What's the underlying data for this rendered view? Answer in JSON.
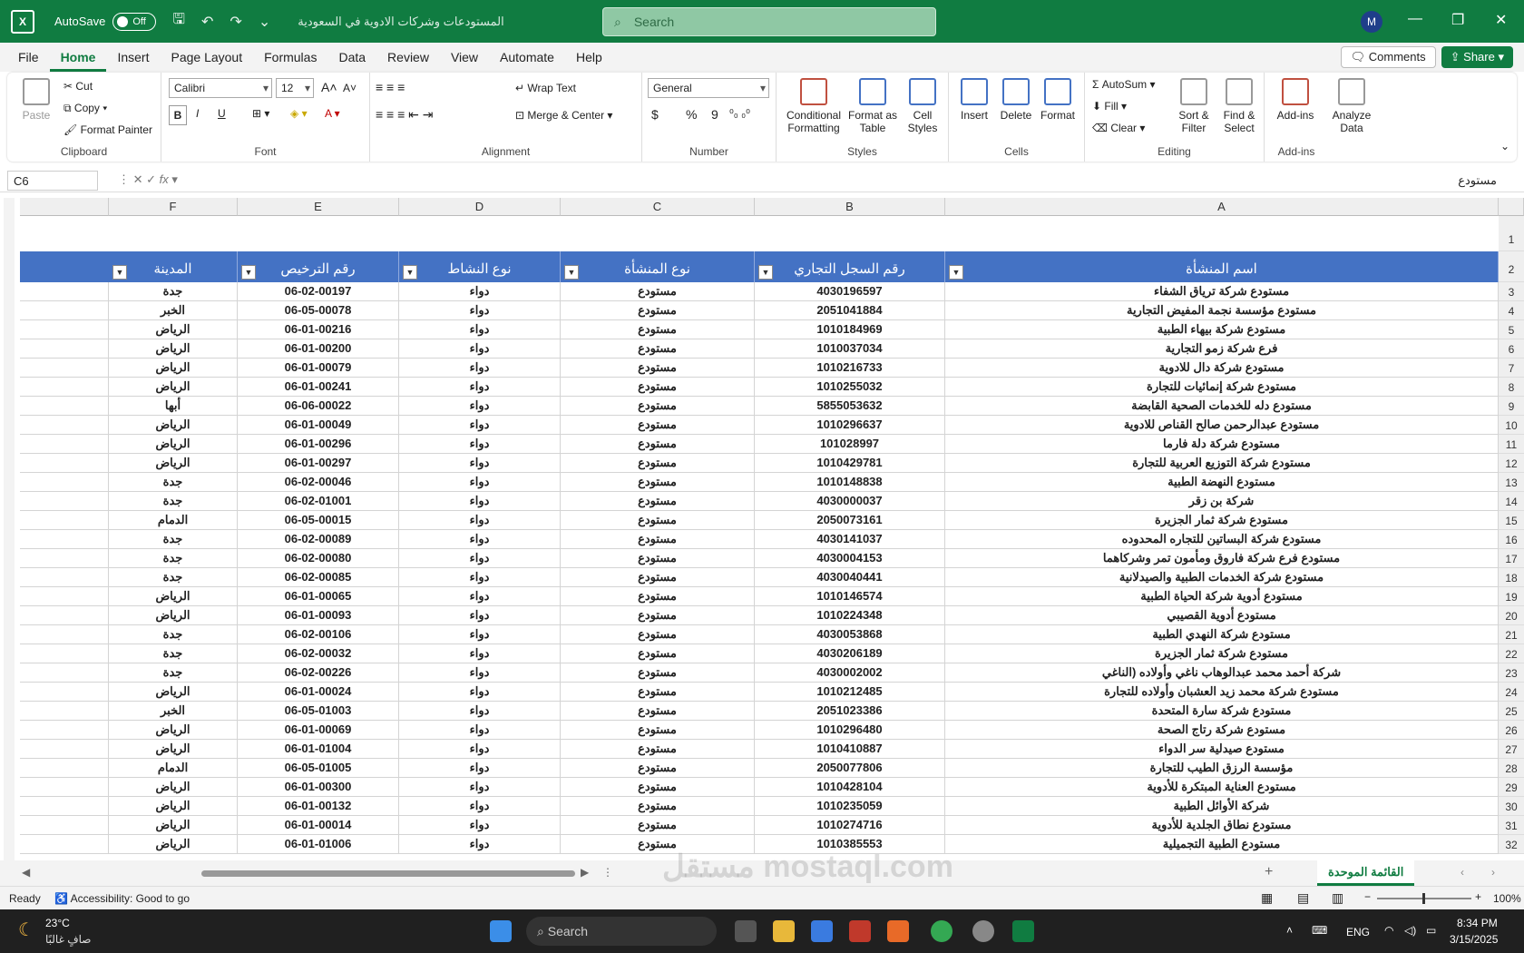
{
  "titlebar": {
    "autosave_label": "AutoSave",
    "autosave_state": "Off",
    "doc_title": "المستودعات وشركات الادوية في السعودية",
    "search_placeholder": "Search",
    "avatar": "M"
  },
  "menus": [
    "File",
    "Home",
    "Insert",
    "Page Layout",
    "Formulas",
    "Data",
    "Review",
    "View",
    "Automate",
    "Help"
  ],
  "menubar": {
    "comments": "Comments",
    "share": "Share"
  },
  "ribbon": {
    "clipboard": {
      "label": "Clipboard",
      "paste": "Paste",
      "cut": "Cut",
      "copy": "Copy",
      "format_painter": "Format Painter"
    },
    "font": {
      "label": "Font",
      "family": "Calibri",
      "size": "12",
      "bold": "B",
      "italic": "I",
      "underline": "U"
    },
    "alignment": {
      "label": "Alignment",
      "wrap": "Wrap Text",
      "merge": "Merge & Center"
    },
    "number": {
      "label": "Number",
      "format": "General",
      "currency": "$",
      "percent": "%",
      "comma": "9"
    },
    "styles": {
      "label": "Styles",
      "conditional": "Conditional Formatting",
      "format_table": "Format as Table",
      "cell_styles": "Cell Styles"
    },
    "cells": {
      "label": "Cells",
      "insert": "Insert",
      "delete": "Delete",
      "format": "Format"
    },
    "editing": {
      "label": "Editing",
      "autosum": "AutoSum",
      "fill": "Fill",
      "clear": "Clear",
      "sort": "Sort & Filter",
      "find": "Find & Select"
    },
    "addins": {
      "label": "Add-ins",
      "addins": "Add-ins",
      "analyze": "Analyze Data"
    }
  },
  "formula_bar": {
    "name_box": "C6",
    "fx": "fx",
    "content": "مستودع"
  },
  "columns": [
    "F",
    "E",
    "D",
    "C",
    "B",
    "A"
  ],
  "headers": {
    "F": "المدينة",
    "E": "رقم الترخيص",
    "D": "نوع النشاط",
    "C": "نوع المنشأة",
    "B": "رقم السجل التجاري",
    "A": "اسم المنشأة"
  },
  "rows": [
    {
      "n": "3",
      "A": "مستودع شركة ترياق الشفاء",
      "B": "4030196597",
      "C": "مستودع",
      "D": "دواء",
      "E": "06-02-00197",
      "F": "جدة"
    },
    {
      "n": "4",
      "A": "مستودع مؤسسة نجمة المفيض التجارية",
      "B": "2051041884",
      "C": "مستودع",
      "D": "دواء",
      "E": "06-05-00078",
      "F": "الخبر"
    },
    {
      "n": "5",
      "A": "مستودع شركة بيهاء الطبية",
      "B": "1010184969",
      "C": "مستودع",
      "D": "دواء",
      "E": "06-01-00216",
      "F": "الرياض"
    },
    {
      "n": "6",
      "A": "فرع شركة زمو التجارية",
      "B": "1010037034",
      "C": "مستودع",
      "D": "دواء",
      "E": "06-01-00200",
      "F": "الرياض"
    },
    {
      "n": "7",
      "A": "مستودع شركة دال للادوية",
      "B": "1010216733",
      "C": "مستودع",
      "D": "دواء",
      "E": "06-01-00079",
      "F": "الرياض"
    },
    {
      "n": "8",
      "A": "مستودع شركة إنمائيات للتجارة",
      "B": "1010255032",
      "C": "مستودع",
      "D": "دواء",
      "E": "06-01-00241",
      "F": "الرياض"
    },
    {
      "n": "9",
      "A": "مستودع دله للخدمات الصحية القابضة",
      "B": "5855053632",
      "C": "مستودع",
      "D": "دواء",
      "E": "06-06-00022",
      "F": "أبها"
    },
    {
      "n": "10",
      "A": "مستودع عبدالرحمن صالح القناص للادوية",
      "B": "1010296637",
      "C": "مستودع",
      "D": "دواء",
      "E": "06-01-00049",
      "F": "الرياض"
    },
    {
      "n": "11",
      "A": "مستودع شركة دلة فارما",
      "B": "101028997",
      "C": "مستودع",
      "D": "دواء",
      "E": "06-01-00296",
      "F": "الرياض"
    },
    {
      "n": "12",
      "A": "مستودع شركة التوزيع العربية للتجارة",
      "B": "1010429781",
      "C": "مستودع",
      "D": "دواء",
      "E": "06-01-00297",
      "F": "الرياض"
    },
    {
      "n": "13",
      "A": "مستودع النهضة الطبية",
      "B": "1010148838",
      "C": "مستودع",
      "D": "دواء",
      "E": "06-02-00046",
      "F": "جدة"
    },
    {
      "n": "14",
      "A": "شركة بن زقر",
      "B": "4030000037",
      "C": "مستودع",
      "D": "دواء",
      "E": "06-02-01001",
      "F": "جدة"
    },
    {
      "n": "15",
      "A": "مستودع شركة ثمار الجزيرة",
      "B": "2050073161",
      "C": "مستودع",
      "D": "دواء",
      "E": "06-05-00015",
      "F": "الدمام"
    },
    {
      "n": "16",
      "A": "مستودع شركة البساتين للتجاره المحدوده",
      "B": "4030141037",
      "C": "مستودع",
      "D": "دواء",
      "E": "06-02-00089",
      "F": "جدة"
    },
    {
      "n": "17",
      "A": "مستودع فرع شركة فاروق ومأمون تمر وشركاهما",
      "B": "4030004153",
      "C": "مستودع",
      "D": "دواء",
      "E": "06-02-00080",
      "F": "جدة"
    },
    {
      "n": "18",
      "A": "مستودع شركة الخدمات الطبية والصيدلانية",
      "B": "4030040441",
      "C": "مستودع",
      "D": "دواء",
      "E": "06-02-00085",
      "F": "جدة"
    },
    {
      "n": "19",
      "A": "مستودع أدوية شركة الحياة الطبية",
      "B": "1010146574",
      "C": "مستودع",
      "D": "دواء",
      "E": "06-01-00065",
      "F": "الرياض"
    },
    {
      "n": "20",
      "A": "مستودع أدوية القصيبي",
      "B": "1010224348",
      "C": "مستودع",
      "D": "دواء",
      "E": "06-01-00093",
      "F": "الرياض"
    },
    {
      "n": "21",
      "A": "مستودع شركة النهدي الطبية",
      "B": "4030053868",
      "C": "مستودع",
      "D": "دواء",
      "E": "06-02-00106",
      "F": "جدة"
    },
    {
      "n": "22",
      "A": "مستودع شركة ثمار الجزيرة",
      "B": "4030206189",
      "C": "مستودع",
      "D": "دواء",
      "E": "06-02-00032",
      "F": "جدة"
    },
    {
      "n": "23",
      "A": "شركة أحمد محمد عبدالوهاب ناغي وأولاده (الناغي",
      "B": "4030002002",
      "C": "مستودع",
      "D": "دواء",
      "E": "06-02-00226",
      "F": "جدة"
    },
    {
      "n": "24",
      "A": "مستودع شركة محمد زيد العشبان وأولاده للتجارة",
      "B": "1010212485",
      "C": "مستودع",
      "D": "دواء",
      "E": "06-01-00024",
      "F": "الرياض"
    },
    {
      "n": "25",
      "A": "مستودع شركة سارة المتحدة",
      "B": "2051023386",
      "C": "مستودع",
      "D": "دواء",
      "E": "06-05-01003",
      "F": "الخبر"
    },
    {
      "n": "26",
      "A": "مستودع شركة رتاج الصحة",
      "B": "1010296480",
      "C": "مستودع",
      "D": "دواء",
      "E": "06-01-00069",
      "F": "الرياض"
    },
    {
      "n": "27",
      "A": "مستودع صيدلية سر الدواء",
      "B": "1010410887",
      "C": "مستودع",
      "D": "دواء",
      "E": "06-01-01004",
      "F": "الرياض"
    },
    {
      "n": "28",
      "A": "مؤسسة الرزق الطيب للتجارة",
      "B": "2050077806",
      "C": "مستودع",
      "D": "دواء",
      "E": "06-05-01005",
      "F": "الدمام"
    },
    {
      "n": "29",
      "A": "مستودع العناية المبتكرة للأدوية",
      "B": "1010428104",
      "C": "مستودع",
      "D": "دواء",
      "E": "06-01-00300",
      "F": "الرياض"
    },
    {
      "n": "30",
      "A": "شركة الأوائل الطبية",
      "B": "1010235059",
      "C": "مستودع",
      "D": "دواء",
      "E": "06-01-00132",
      "F": "الرياض"
    },
    {
      "n": "31",
      "A": "مستودع نطاق الجلدية للأدوية",
      "B": "1010274716",
      "C": "مستودع",
      "D": "دواء",
      "E": "06-01-00014",
      "F": "الرياض"
    },
    {
      "n": "32",
      "A": "مستودع الطبية التجميلية",
      "B": "1010385553",
      "C": "مستودع",
      "D": "دواء",
      "E": "06-01-01006",
      "F": "الرياض"
    }
  ],
  "sheet_tab": "القائمة الموحدة",
  "status": {
    "ready": "Ready",
    "accessibility": "Accessibility: Good to go",
    "zoom": "100%"
  },
  "taskbar": {
    "temp": "23°C",
    "weather": "صافٍ غالبًا",
    "search": "Search",
    "lang": "ENG",
    "time": "8:34 PM",
    "date": "3/15/2025"
  },
  "watermark": "مستقل mostaql.com",
  "colors": {
    "excel_green": "#107c41",
    "table_header": "#4472c4"
  }
}
